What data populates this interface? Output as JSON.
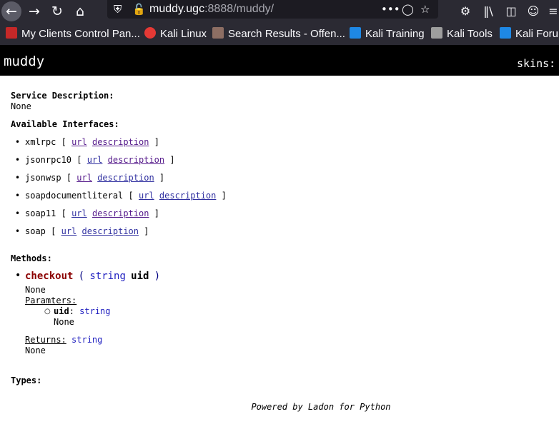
{
  "browser": {
    "url_host": "muddy.ugc",
    "url_rest": ":8888/muddy/",
    "nav_icons": [
      "back-arrow-icon",
      "forward-arrow-icon",
      "reload-icon",
      "home-icon"
    ],
    "url_icons": [
      "shield-icon",
      "insecure-lock-icon",
      "more-dots-icon",
      "pocket-icon",
      "bookmark-star-icon"
    ],
    "toolbar_icons": [
      "extension-gear-icon",
      "library-icon",
      "sidebar-icon",
      "account-icon",
      "menu-icon"
    ],
    "bookmarks": [
      {
        "label": "My Clients Control Pan...",
        "icon": "red-panel-icon",
        "color": "#c62828"
      },
      {
        "label": "Kali Linux",
        "icon": "kali-logo-icon",
        "color": "#e53935"
      },
      {
        "label": "Search Results - Offen...",
        "icon": "offsec-logo-icon",
        "color": "#8d6e63"
      },
      {
        "label": "Kali Training",
        "icon": "kali-training-icon",
        "color": "#1e88e5"
      },
      {
        "label": "Kali Tools",
        "icon": "kali-dragon-icon",
        "color": "#9e9e9e"
      },
      {
        "label": "Kali Forum",
        "icon": "kali-forum-icon",
        "color": "#1e88e5"
      }
    ]
  },
  "page": {
    "title": "muddy",
    "skins_label": "skins:",
    "service_description_label": "Service Description:",
    "service_description_value": "None",
    "available_interfaces_label": "Available Interfaces:",
    "interfaces": [
      {
        "name": "xmlrpc",
        "url": "url",
        "description": "description"
      },
      {
        "name": "jsonrpc10",
        "url": "url",
        "description": "description"
      },
      {
        "name": "jsonwsp",
        "url": "url",
        "description": "description"
      },
      {
        "name": "soapdocumentliteral",
        "url": "url",
        "description": "description"
      },
      {
        "name": "soap11",
        "url": "url",
        "description": "description"
      },
      {
        "name": "soap",
        "url": "url",
        "description": "description"
      }
    ],
    "bracket_open": "[",
    "bracket_close": "]",
    "methods_label": "Methods:",
    "method": {
      "name": "checkout",
      "paren_open": "(",
      "arg_type": "string",
      "arg_name": "uid",
      "paren_close": ")",
      "doc": "None",
      "params_label": "Paramters:",
      "param_name": "uid",
      "param_type": "string",
      "param_doc": "None",
      "returns_label": "Returns:",
      "returns_type": "string",
      "returns_doc": "None"
    },
    "types_label": "Types:",
    "footer": "Powered by Ladon for Python"
  }
}
